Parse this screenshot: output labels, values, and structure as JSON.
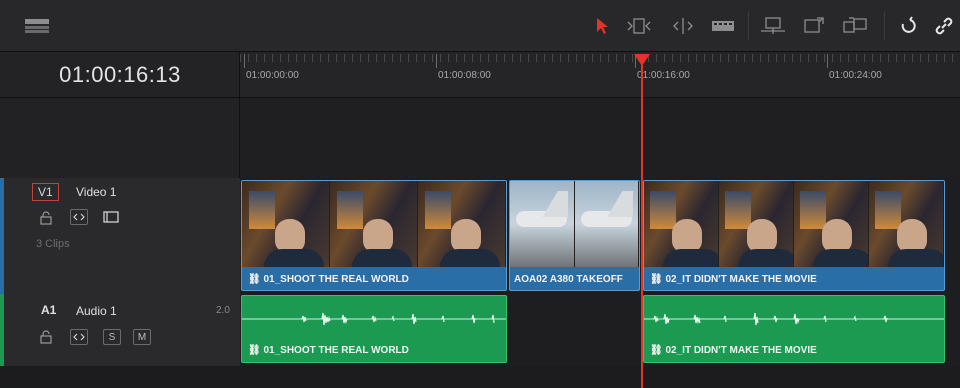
{
  "toolbar": {
    "icons": [
      "layout-icon",
      "pointer-icon",
      "trim-icon",
      "dynamic-trim-icon",
      "blade-icon",
      "insert-icon",
      "overwrite-icon",
      "replace-icon",
      "snapping-icon",
      "link-icon"
    ],
    "accent": "#e5332a"
  },
  "timecode": "01:00:16:13",
  "ruler": {
    "labels": [
      "01:00:00:00",
      "01:00:08:00",
      "01:00:16:00",
      "01:00:24:00"
    ]
  },
  "tracks": {
    "video": {
      "tag": "V1",
      "name": "Video 1",
      "clip_count": "3 Clips",
      "color": "#2a6ea8"
    },
    "audio": {
      "tag": "A1",
      "name": "Audio 1",
      "channels": "2.0",
      "solo": "S",
      "mute": "M",
      "color": "#1c9a52"
    }
  },
  "clips": {
    "v1": "01_SHOOT THE REAL WORLD",
    "v2": "AOA02 A380 TAKEOFF",
    "v3": "02_IT DIDN'T MAKE THE MOVIE",
    "a1": "01_SHOOT THE REAL WORLD",
    "a2": "02_IT DIDN'T MAKE THE MOVIE"
  }
}
